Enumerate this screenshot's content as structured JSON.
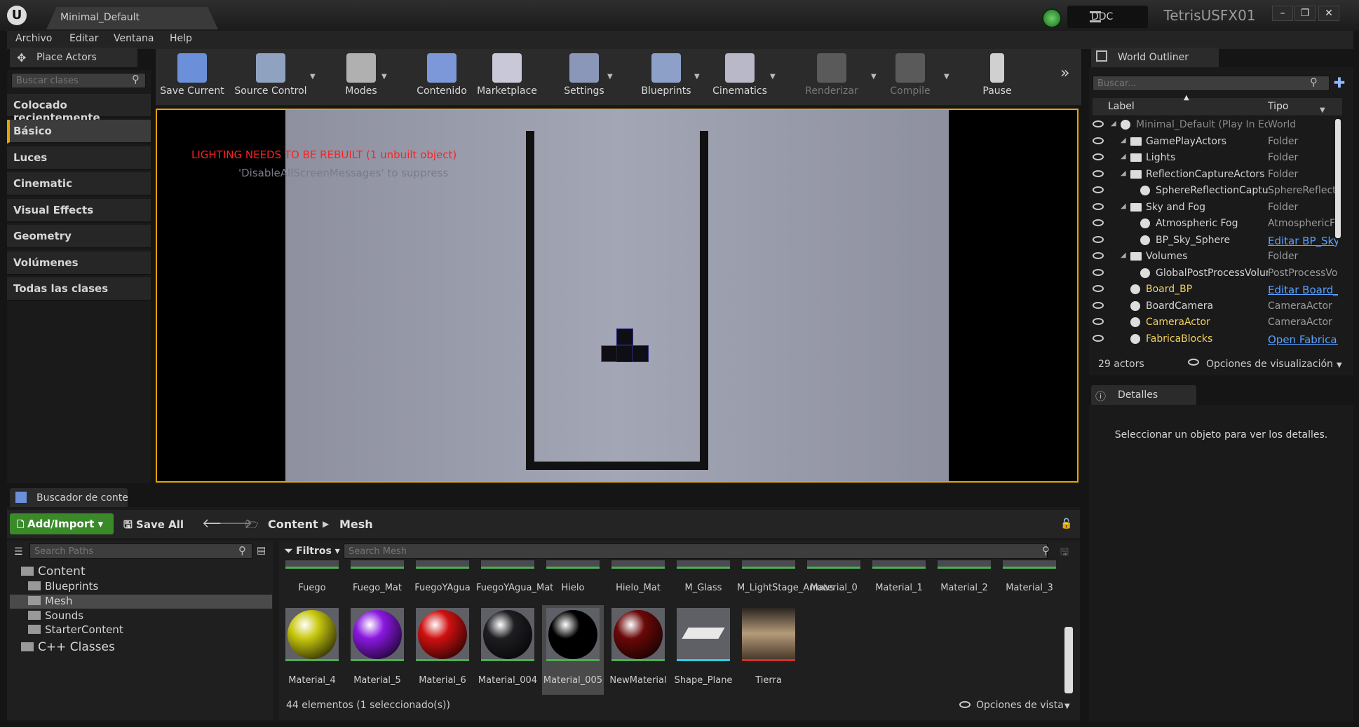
{
  "title_bar": {
    "logo": "U",
    "doc_tab": "Minimal_Default",
    "ddc": "DDC",
    "project": "TetrisUSFX01",
    "minimize": "–",
    "maximize": "❐",
    "close": "✕"
  },
  "menu": [
    "Archivo",
    "Editar",
    "Ventana",
    "Help"
  ],
  "place_actors": {
    "tab": "Place Actors",
    "search_placeholder": "Buscar clases",
    "categories": [
      "Colocado recientemente",
      "Básico",
      "Luces",
      "Cinematic",
      "Visual Effects",
      "Geometry",
      "Volúmenes",
      "Todas las clases"
    ],
    "active_category": "Básico"
  },
  "toolbar": [
    {
      "label": "Save Current",
      "icon": "save-icon",
      "color": "#6b8fd8"
    },
    {
      "label": "Source Control",
      "icon": "source-control-icon",
      "color": "#8fa3c0"
    },
    {
      "label": "Modes",
      "icon": "modes-icon",
      "color": "#b0b0b0"
    },
    {
      "label": "Contenido",
      "icon": "content-icon",
      "color": "#7d98d8"
    },
    {
      "label": "Marketplace",
      "icon": "marketplace-icon",
      "color": "#c8c8d8"
    },
    {
      "label": "Settings",
      "icon": "settings-icon",
      "color": "#8a97b8"
    },
    {
      "label": "Blueprints",
      "icon": "blueprints-icon",
      "color": "#8da0c8"
    },
    {
      "label": "Cinematics",
      "icon": "cinematics-icon",
      "color": "#b8b8c8"
    },
    {
      "label": "Renderizar",
      "icon": "build-icon",
      "color": "#5a5a5a"
    },
    {
      "label": "Compile",
      "icon": "compile-icon",
      "color": "#5a5a5a"
    },
    {
      "label": "Pause",
      "icon": "pause-icon",
      "color": "#d0d0d0"
    }
  ],
  "viewport": {
    "lighting_warning": "LIGHTING NEEDS TO BE REBUILT (1 unbuilt object)",
    "suppress_hint": "'DisableAllScreenMessages' to suppress"
  },
  "world_outliner": {
    "tab": "World Outliner",
    "search_placeholder": "Buscar...",
    "col_label": "Label",
    "col_tipo": "Tipo",
    "rows": [
      {
        "label": "Minimal_Default (Play In Editor)",
        "tipo": "World",
        "indent": 0,
        "kind": "world",
        "dim": true
      },
      {
        "label": "GamePlayActors",
        "tipo": "Folder",
        "indent": 1,
        "kind": "folder"
      },
      {
        "label": "Lights",
        "tipo": "Folder",
        "indent": 1,
        "kind": "folder"
      },
      {
        "label": "ReflectionCaptureActors",
        "tipo": "Folder",
        "indent": 1,
        "kind": "folder"
      },
      {
        "label": "SphereReflectionCapture",
        "tipo": "SphereReflectionCapture",
        "indent": 2,
        "kind": "actor"
      },
      {
        "label": "Sky and Fog",
        "tipo": "Folder",
        "indent": 1,
        "kind": "folder"
      },
      {
        "label": "Atmospheric Fog",
        "tipo": "AtmosphericFog",
        "indent": 2,
        "kind": "actor"
      },
      {
        "label": "BP_Sky_Sphere",
        "tipo": "Editar BP_Sky_Sphere",
        "indent": 2,
        "kind": "actor",
        "link": true
      },
      {
        "label": "Volumes",
        "tipo": "Folder",
        "indent": 1,
        "kind": "folder"
      },
      {
        "label": "GlobalPostProcessVolume",
        "tipo": "PostProcessVolume",
        "indent": 2,
        "kind": "actor"
      },
      {
        "label": "Board_BP",
        "tipo": "Editar Board_BP",
        "indent": 1,
        "kind": "actor",
        "link": true,
        "yellow": true
      },
      {
        "label": "BoardCamera",
        "tipo": "CameraActor",
        "indent": 1,
        "kind": "actor"
      },
      {
        "label": "CameraActor",
        "tipo": "CameraActor",
        "indent": 1,
        "kind": "actor",
        "yellow": true
      },
      {
        "label": "FabricaBlocks",
        "tipo": "Open FabricaBlocks",
        "indent": 1,
        "kind": "actor",
        "link": true,
        "yellow": true
      }
    ],
    "actor_count": "29 actors",
    "view_options": "Opciones de visualización"
  },
  "details": {
    "tab": "Detalles",
    "empty_message": "Seleccionar un objeto para ver los detalles."
  },
  "content_browser": {
    "tab": "Buscador de contenido",
    "add_import": "Add/Import",
    "save_all": "Save All",
    "path": [
      "Content",
      "Mesh"
    ],
    "search_paths_placeholder": "Search Paths",
    "filters": "Filtros",
    "search_mesh_placeholder": "Search Mesh",
    "tree": [
      {
        "label": "Content",
        "indent": 0,
        "selected": false
      },
      {
        "label": "Blueprints",
        "indent": 1,
        "selected": false
      },
      {
        "label": "Mesh",
        "indent": 1,
        "selected": true
      },
      {
        "label": "Sounds",
        "indent": 1,
        "selected": false
      },
      {
        "label": "StarterContent",
        "indent": 1,
        "selected": false
      },
      {
        "label": "C++ Classes",
        "indent": 0,
        "selected": false
      }
    ],
    "assets_row1": [
      "Fuego",
      "Fuego_Mat",
      "FuegoYAgua",
      "FuegoYAgua_Mat",
      "Hielo",
      "Hielo_Mat",
      "M_Glass",
      "M_LightStage_Arrows",
      "Material_0",
      "Material_1",
      "Material_2",
      "Material_3"
    ],
    "assets_row2": [
      {
        "name": "Material_4",
        "color": "#c8c810"
      },
      {
        "name": "Material_5",
        "color": "#8a18e0"
      },
      {
        "name": "Material_6",
        "color": "#d01010"
      },
      {
        "name": "Material_004",
        "color": "#1e1e22"
      },
      {
        "name": "Material_005",
        "color": "#000000"
      },
      {
        "name": "NewMaterial",
        "color": "#6a0808"
      },
      {
        "name": "Shape_Plane",
        "color": "#e8e8e8"
      },
      {
        "name": "Tierra",
        "color": "#7a6a55"
      }
    ],
    "status": "44 elementos (1 seleccionado(s))",
    "view_options": "Opciones de vista"
  }
}
